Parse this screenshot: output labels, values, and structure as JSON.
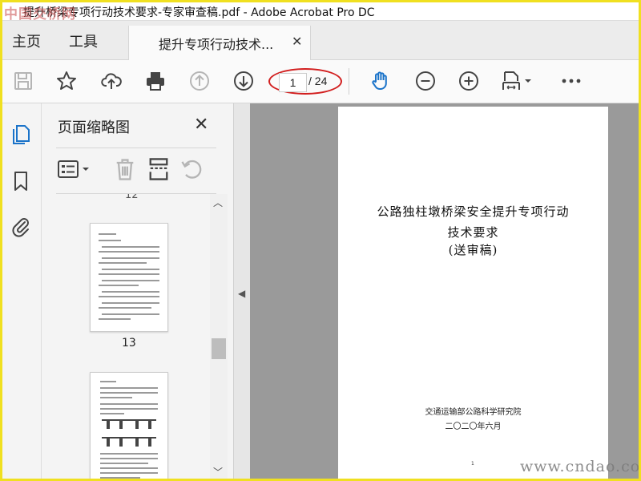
{
  "window": {
    "title": "提升桥梁专项行动技术要求-专家审查稿.pdf - Adobe Acrobat Pro DC",
    "watermark_top": "中国交桥网"
  },
  "nav": {
    "home": "主页",
    "tools": "工具"
  },
  "tab": {
    "label": "提升专项行动技术...",
    "close": "✕"
  },
  "toolbar": {
    "icons": [
      "save-icon",
      "bookmark-star-icon",
      "cloud-upload-icon",
      "print-icon",
      "page-up-icon",
      "page-down-icon",
      "hand-tool-icon",
      "zoom-out-icon",
      "zoom-in-icon",
      "page-fit-icon",
      "more-icon"
    ],
    "page_current": "1",
    "page_total": "/ 24",
    "highlight_color": "#d21f1f",
    "accent_color": "#1a73c9"
  },
  "panel": {
    "title": "页面缩略图",
    "close": "✕",
    "prev_page_label": "12",
    "thumbnails": [
      {
        "label": "13"
      },
      {
        "label": ""
      }
    ]
  },
  "document": {
    "title_line1": "公路独柱墩桥梁安全提升专项行动",
    "title_line2": "技术要求",
    "title_line3": "(送审稿)",
    "org": "交通运输部公路科学研究院",
    "date": "二〇二〇年六月",
    "page_number": "1"
  },
  "watermark_bottom": "www.cndao.com"
}
